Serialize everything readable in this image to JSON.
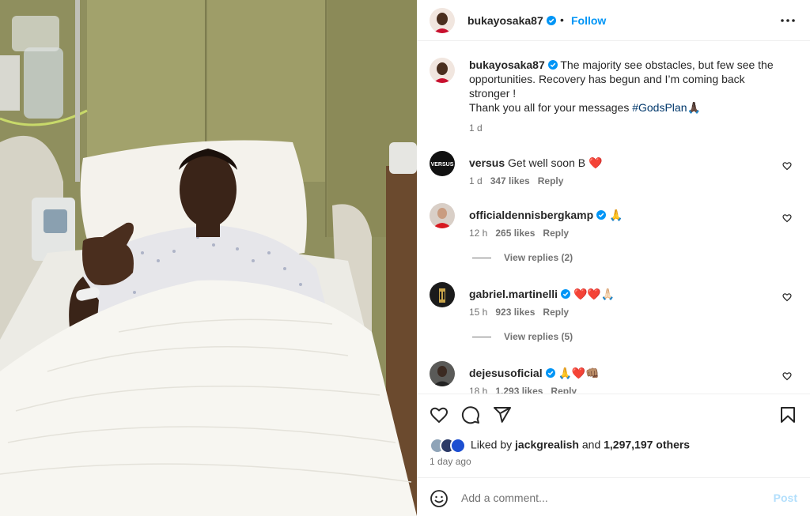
{
  "post": {
    "author": "bukayosaka87",
    "follow_label": "Follow",
    "separator": "•",
    "caption_lines": [
      "The majority see obstacles, but few see the",
      "opportunities. Recovery has begun and I’m coming back",
      "stronger !"
    ],
    "caption_thanks": "Thank you all for your messages ",
    "hashtag": "#GodsPlan",
    "caption_emoji": "🙏🏿",
    "caption_age": "1 d"
  },
  "comments": [
    {
      "user": "versus",
      "verified": false,
      "text": "Get well soon B ❤️",
      "age": "1 d",
      "likes": "347 likes",
      "reply": "Reply"
    },
    {
      "user": "officialdennisbergkamp",
      "verified": true,
      "text": "🙏",
      "age": "12 h",
      "likes": "265 likes",
      "reply": "Reply",
      "view_replies": "View replies (2)"
    },
    {
      "user": "gabriel.martinelli",
      "verified": true,
      "text": "❤️❤️🙏🏻",
      "age": "15 h",
      "likes": "923 likes",
      "reply": "Reply",
      "view_replies": "View replies (5)"
    },
    {
      "user": "dejesusoficial",
      "verified": true,
      "text": "🙏❤️👊🏽",
      "age": "18 h",
      "likes": "1,293 likes",
      "reply": "Reply"
    }
  ],
  "likes": {
    "prefix": "Liked by ",
    "user": "jackgrealish",
    "middle": " and ",
    "others": "1,297,197 others"
  },
  "posted_ago": "1 day ago",
  "composer": {
    "placeholder": "Add a comment...",
    "post_label": "Post"
  },
  "colors": {
    "link_blue": "#0095f6",
    "hashtag": "#00376b",
    "muted": "#737373",
    "post_disabled": "#b2dffc",
    "verified": "#0095f6"
  },
  "icons": [
    "verified-icon",
    "more-icon",
    "heart-icon",
    "comment-icon",
    "share-icon",
    "bookmark-icon",
    "emoji-icon"
  ]
}
